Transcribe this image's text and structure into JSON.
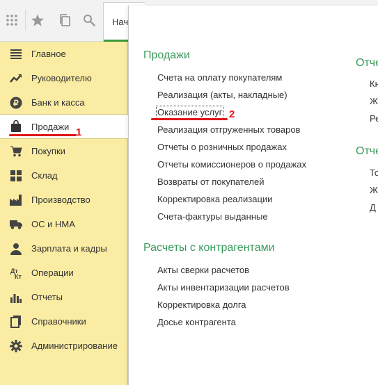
{
  "toolbar": {
    "icons": [
      "apps-grid-icon",
      "star-icon",
      "history-icon",
      "search-icon"
    ],
    "start_tab_label": "Нач"
  },
  "sidebar": {
    "items": [
      {
        "label": "Главное",
        "icon": "menu-lines-icon"
      },
      {
        "label": "Руководителю",
        "icon": "trend-icon"
      },
      {
        "label": "Банк и касса",
        "icon": "ruble-coin-icon"
      },
      {
        "label": "Продажи",
        "icon": "shopping-bag-icon",
        "active": true
      },
      {
        "label": "Покупки",
        "icon": "cart-icon"
      },
      {
        "label": "Склад",
        "icon": "warehouse-grid-icon"
      },
      {
        "label": "Производство",
        "icon": "factory-icon"
      },
      {
        "label": "ОС и НМА",
        "icon": "truck-icon"
      },
      {
        "label": "Зарплата и кадры",
        "icon": "person-icon"
      },
      {
        "label": "Операции",
        "icon": "debit-credit-icon"
      },
      {
        "label": "Отчеты",
        "icon": "bar-chart-icon"
      },
      {
        "label": "Справочники",
        "icon": "books-icon"
      },
      {
        "label": "Администрирование",
        "icon": "gear-icon"
      }
    ]
  },
  "panel": {
    "sections": [
      {
        "title": "Продажи",
        "links": [
          "Счета на оплату покупателям",
          "Реализация (акты, накладные)",
          "Оказание услуг",
          "Реализация отгруженных товаров",
          "Отчеты о розничных продажах",
          "Отчеты комиссионеров о продажах",
          "Возвраты от покупателей",
          "Корректировка реализации",
          "Счета-фактуры выданные"
        ]
      },
      {
        "title": "Расчеты с контрагентами",
        "links": [
          "Акты сверки расчетов",
          "Акты инвентаризации расчетов",
          "Корректировка долга",
          "Досье контрагента"
        ]
      }
    ],
    "right_column": {
      "section1_title": "Отче",
      "section1_links": [
        "Кн",
        "Ж",
        "Ре"
      ],
      "section2_title": "Отче",
      "section2_links": [
        "То",
        "Ж",
        "Д"
      ]
    }
  },
  "annotations": {
    "marker1": "1",
    "marker2": "2",
    "color": "#e01616"
  }
}
